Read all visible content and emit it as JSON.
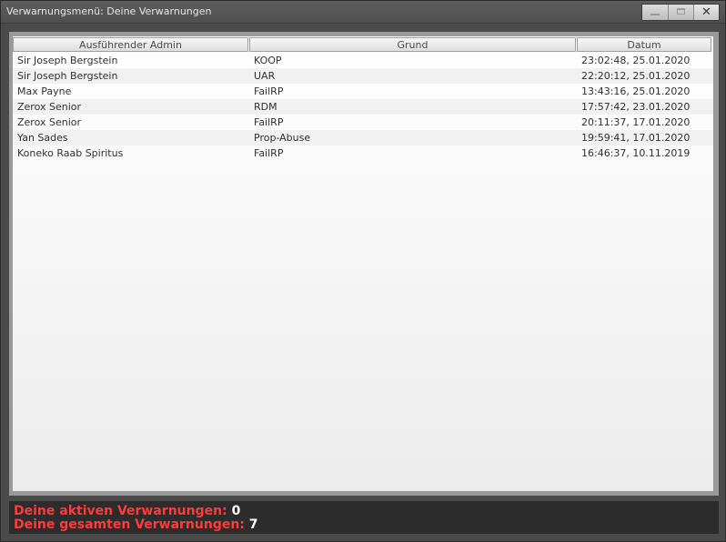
{
  "window": {
    "title": "Verwarnungsmenü: Deine Verwarnungen",
    "buttons": {
      "minimize_icon": "minimize-icon",
      "maximize_icon": "maximize-icon",
      "close_icon": "close-icon",
      "close_glyph": "✕"
    }
  },
  "table": {
    "columns": [
      "Ausführender Admin",
      "Grund",
      "Datum"
    ],
    "rows": [
      {
        "admin": "Sir Joseph Bergstein",
        "reason": "KOOP",
        "date": "23:02:48, 25.01.2020"
      },
      {
        "admin": "Sir Joseph Bergstein",
        "reason": "UAR",
        "date": "22:20:12, 25.01.2020"
      },
      {
        "admin": "Max Payne",
        "reason": "FailRP",
        "date": "13:43:16, 25.01.2020"
      },
      {
        "admin": "Zerox Senior",
        "reason": "RDM",
        "date": "17:57:42, 23.01.2020"
      },
      {
        "admin": "Zerox Senior",
        "reason": "FailRP",
        "date": "20:11:37, 17.01.2020"
      },
      {
        "admin": "Yan Sades",
        "reason": "Prop-Abuse",
        "date": "19:59:41, 17.01.2020"
      },
      {
        "admin": "Koneko Raab Spiritus",
        "reason": "FailRP",
        "date": "16:46:37, 10.11.2019"
      }
    ]
  },
  "status": {
    "active_label": "Deine aktiven Verwarnungen:",
    "active_value": "0",
    "total_label": "Deine gesamten Verwarnungen:",
    "total_value": "7"
  },
  "colors": {
    "status_label": "#ff3b3b",
    "status_value": "#ffffff"
  }
}
